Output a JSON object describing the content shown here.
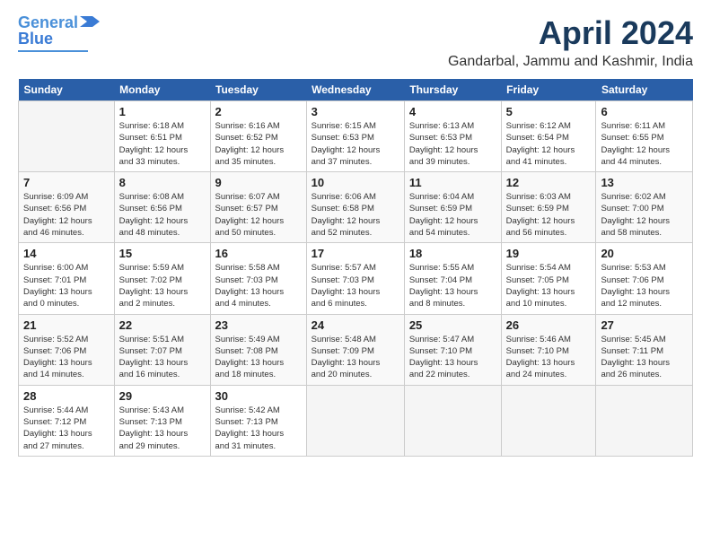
{
  "logo": {
    "line1": "General",
    "line2": "Blue"
  },
  "header": {
    "title": "April 2024",
    "location": "Gandarbal, Jammu and Kashmir, India"
  },
  "weekdays": [
    "Sunday",
    "Monday",
    "Tuesday",
    "Wednesday",
    "Thursday",
    "Friday",
    "Saturday"
  ],
  "weeks": [
    [
      {
        "day": "",
        "detail": ""
      },
      {
        "day": "1",
        "detail": "Sunrise: 6:18 AM\nSunset: 6:51 PM\nDaylight: 12 hours\nand 33 minutes."
      },
      {
        "day": "2",
        "detail": "Sunrise: 6:16 AM\nSunset: 6:52 PM\nDaylight: 12 hours\nand 35 minutes."
      },
      {
        "day": "3",
        "detail": "Sunrise: 6:15 AM\nSunset: 6:53 PM\nDaylight: 12 hours\nand 37 minutes."
      },
      {
        "day": "4",
        "detail": "Sunrise: 6:13 AM\nSunset: 6:53 PM\nDaylight: 12 hours\nand 39 minutes."
      },
      {
        "day": "5",
        "detail": "Sunrise: 6:12 AM\nSunset: 6:54 PM\nDaylight: 12 hours\nand 41 minutes."
      },
      {
        "day": "6",
        "detail": "Sunrise: 6:11 AM\nSunset: 6:55 PM\nDaylight: 12 hours\nand 44 minutes."
      }
    ],
    [
      {
        "day": "7",
        "detail": "Sunrise: 6:09 AM\nSunset: 6:56 PM\nDaylight: 12 hours\nand 46 minutes."
      },
      {
        "day": "8",
        "detail": "Sunrise: 6:08 AM\nSunset: 6:56 PM\nDaylight: 12 hours\nand 48 minutes."
      },
      {
        "day": "9",
        "detail": "Sunrise: 6:07 AM\nSunset: 6:57 PM\nDaylight: 12 hours\nand 50 minutes."
      },
      {
        "day": "10",
        "detail": "Sunrise: 6:06 AM\nSunset: 6:58 PM\nDaylight: 12 hours\nand 52 minutes."
      },
      {
        "day": "11",
        "detail": "Sunrise: 6:04 AM\nSunset: 6:59 PM\nDaylight: 12 hours\nand 54 minutes."
      },
      {
        "day": "12",
        "detail": "Sunrise: 6:03 AM\nSunset: 6:59 PM\nDaylight: 12 hours\nand 56 minutes."
      },
      {
        "day": "13",
        "detail": "Sunrise: 6:02 AM\nSunset: 7:00 PM\nDaylight: 12 hours\nand 58 minutes."
      }
    ],
    [
      {
        "day": "14",
        "detail": "Sunrise: 6:00 AM\nSunset: 7:01 PM\nDaylight: 13 hours\nand 0 minutes."
      },
      {
        "day": "15",
        "detail": "Sunrise: 5:59 AM\nSunset: 7:02 PM\nDaylight: 13 hours\nand 2 minutes."
      },
      {
        "day": "16",
        "detail": "Sunrise: 5:58 AM\nSunset: 7:03 PM\nDaylight: 13 hours\nand 4 minutes."
      },
      {
        "day": "17",
        "detail": "Sunrise: 5:57 AM\nSunset: 7:03 PM\nDaylight: 13 hours\nand 6 minutes."
      },
      {
        "day": "18",
        "detail": "Sunrise: 5:55 AM\nSunset: 7:04 PM\nDaylight: 13 hours\nand 8 minutes."
      },
      {
        "day": "19",
        "detail": "Sunrise: 5:54 AM\nSunset: 7:05 PM\nDaylight: 13 hours\nand 10 minutes."
      },
      {
        "day": "20",
        "detail": "Sunrise: 5:53 AM\nSunset: 7:06 PM\nDaylight: 13 hours\nand 12 minutes."
      }
    ],
    [
      {
        "day": "21",
        "detail": "Sunrise: 5:52 AM\nSunset: 7:06 PM\nDaylight: 13 hours\nand 14 minutes."
      },
      {
        "day": "22",
        "detail": "Sunrise: 5:51 AM\nSunset: 7:07 PM\nDaylight: 13 hours\nand 16 minutes."
      },
      {
        "day": "23",
        "detail": "Sunrise: 5:49 AM\nSunset: 7:08 PM\nDaylight: 13 hours\nand 18 minutes."
      },
      {
        "day": "24",
        "detail": "Sunrise: 5:48 AM\nSunset: 7:09 PM\nDaylight: 13 hours\nand 20 minutes."
      },
      {
        "day": "25",
        "detail": "Sunrise: 5:47 AM\nSunset: 7:10 PM\nDaylight: 13 hours\nand 22 minutes."
      },
      {
        "day": "26",
        "detail": "Sunrise: 5:46 AM\nSunset: 7:10 PM\nDaylight: 13 hours\nand 24 minutes."
      },
      {
        "day": "27",
        "detail": "Sunrise: 5:45 AM\nSunset: 7:11 PM\nDaylight: 13 hours\nand 26 minutes."
      }
    ],
    [
      {
        "day": "28",
        "detail": "Sunrise: 5:44 AM\nSunset: 7:12 PM\nDaylight: 13 hours\nand 27 minutes."
      },
      {
        "day": "29",
        "detail": "Sunrise: 5:43 AM\nSunset: 7:13 PM\nDaylight: 13 hours\nand 29 minutes."
      },
      {
        "day": "30",
        "detail": "Sunrise: 5:42 AM\nSunset: 7:13 PM\nDaylight: 13 hours\nand 31 minutes."
      },
      {
        "day": "",
        "detail": ""
      },
      {
        "day": "",
        "detail": ""
      },
      {
        "day": "",
        "detail": ""
      },
      {
        "day": "",
        "detail": ""
      }
    ]
  ]
}
